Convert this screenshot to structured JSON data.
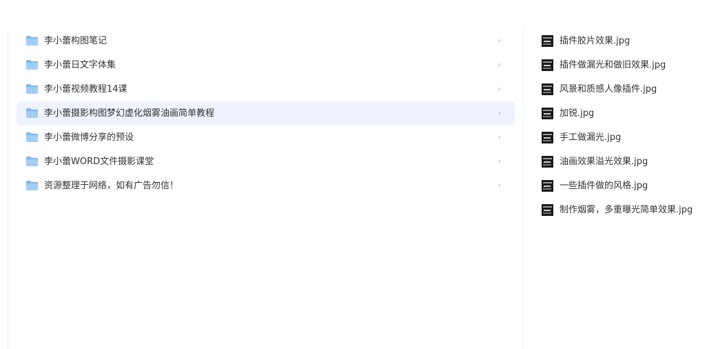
{
  "folders": [
    {
      "label": "李小蕾构图笔记",
      "selected": false
    },
    {
      "label": "李小蕾日文字体集",
      "selected": false
    },
    {
      "label": "李小蕾视频教程14课",
      "selected": false
    },
    {
      "label": "李小蕾摄影构图梦幻虚化烟雾油画简单教程",
      "selected": true
    },
    {
      "label": "李小蕾微博分享的预设",
      "selected": false
    },
    {
      "label": "李小蕾WORD文件摄影课堂",
      "selected": false
    },
    {
      "label": "资源整理于网络，如有广告勿信！",
      "selected": false
    }
  ],
  "chevron_glyph": "›",
  "files": [
    {
      "label": "插件胶片效果.jpg"
    },
    {
      "label": "插件做漏光和做旧效果.jpg"
    },
    {
      "label": "风景和质感人像插件.jpg"
    },
    {
      "label": "加锐.jpg"
    },
    {
      "label": "手工做漏光.jpg"
    },
    {
      "label": "油画效果溢光效果.jpg"
    },
    {
      "label": "一些插件做的风格.jpg"
    },
    {
      "label": "制作烟雾，多重曝光简单效果.jpg"
    }
  ],
  "colors": {
    "selected_row_bg": "#eef3fd",
    "folder_icon": "#8ec2f0"
  }
}
